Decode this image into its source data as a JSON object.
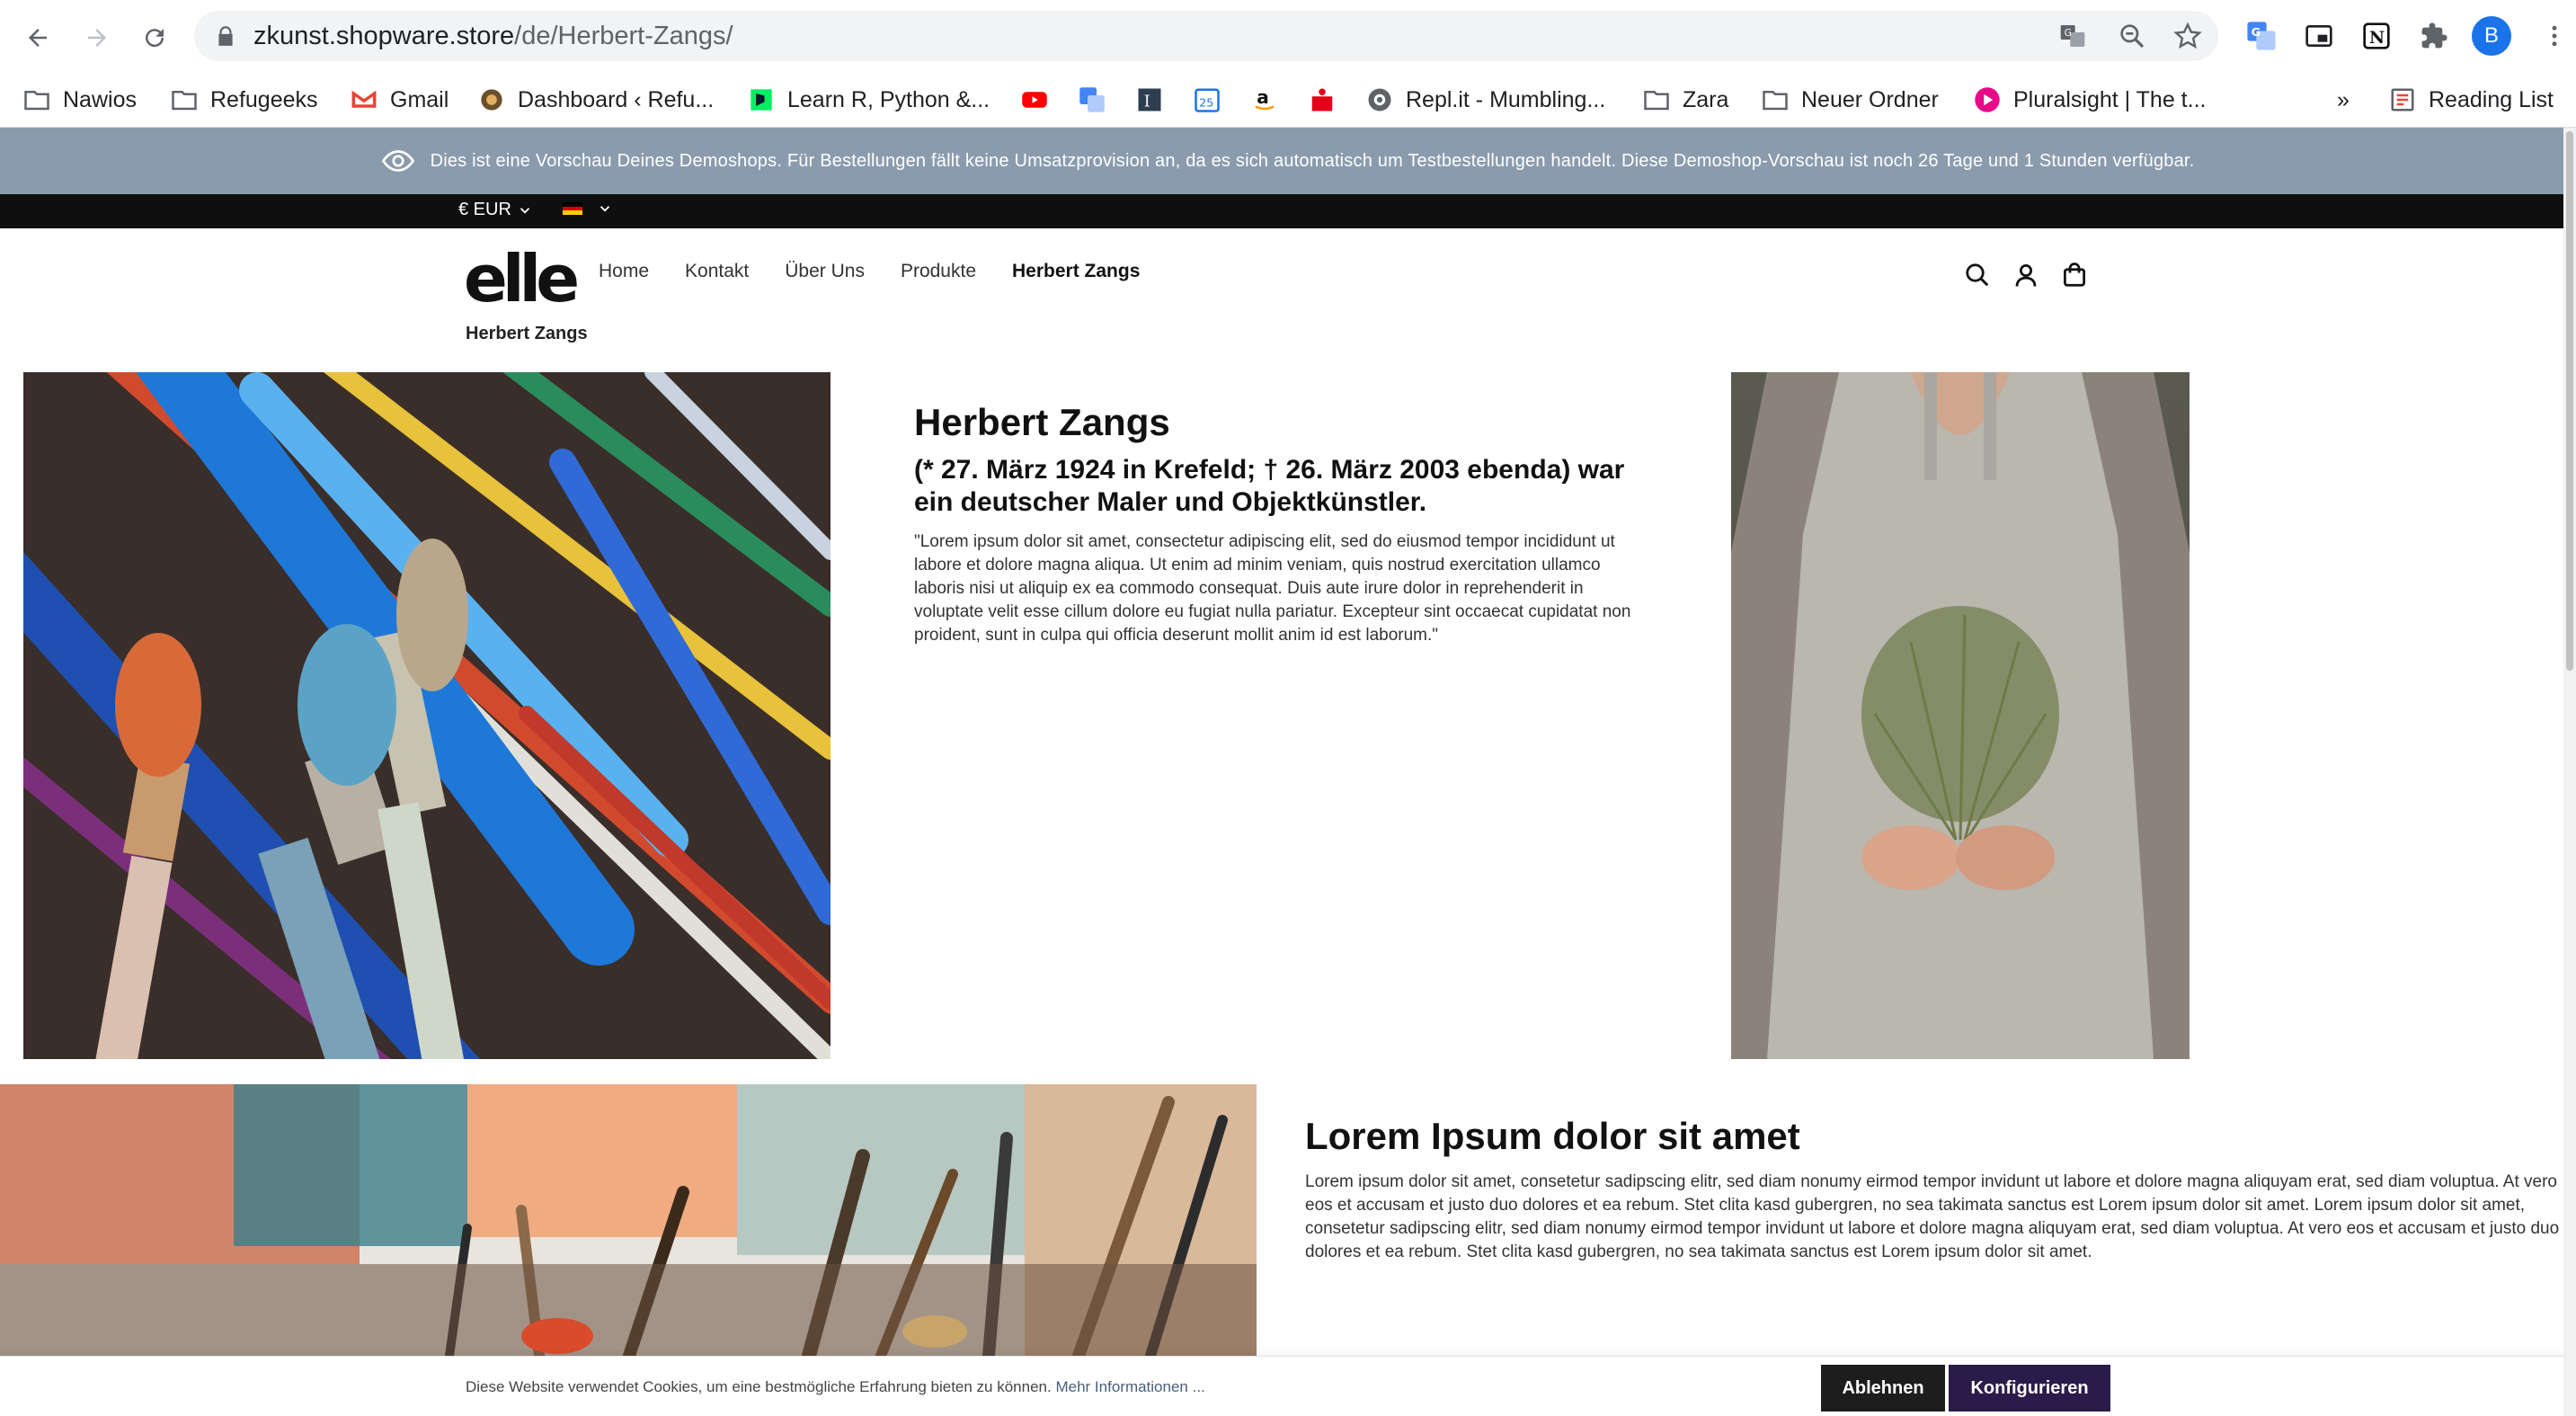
{
  "browser": {
    "url_host": "zkunst.shopware.store",
    "url_path": "/de/Herbert-Zangs/",
    "profile_initial": "B",
    "bookmarks": [
      {
        "label": "Nawios",
        "icon": "folder-icon"
      },
      {
        "label": "Refugeeks",
        "icon": "folder-icon"
      },
      {
        "label": "Gmail",
        "icon": "gmail-icon"
      },
      {
        "label": "Dashboard ‹ Refu...",
        "icon": "site-icon"
      },
      {
        "label": "Learn R, Python &...",
        "icon": "datacamp-icon"
      },
      {
        "label": "",
        "icon": "youtube-icon"
      },
      {
        "label": "",
        "icon": "translate-icon"
      },
      {
        "label": "",
        "icon": "notion-icon"
      },
      {
        "label": "",
        "icon": "calendar-icon"
      },
      {
        "label": "",
        "icon": "amazon-icon"
      },
      {
        "label": "",
        "icon": "sparkasse-icon"
      },
      {
        "label": "Repl.it - Mumbling...",
        "icon": "replit-icon"
      },
      {
        "label": "Zara",
        "icon": "folder-icon"
      },
      {
        "label": "Neuer Ordner",
        "icon": "folder-icon"
      },
      {
        "label": "Pluralsight | The t...",
        "icon": "pluralsight-icon"
      }
    ],
    "overflow": "»",
    "reading_list": "Reading List"
  },
  "preview_banner": "Dies ist eine Vorschau Deines Demoshops. Für Bestellungen fällt keine Umsatzprovision an, da es sich automatisch um Testbestellungen handelt. Diese Demoshop-Vorschau ist noch 26 Tage und 1 Stunden verfügbar.",
  "topbar": {
    "currency": "€ EUR"
  },
  "header": {
    "logo": "elle",
    "nav": [
      "Home",
      "Kontakt",
      "Über Uns",
      "Produkte",
      "Herbert Zangs"
    ],
    "breadcrumb": "Herbert Zangs"
  },
  "bio": {
    "title": "Herbert Zangs",
    "subtitle": "(* 27. März 1924 in Krefeld; † 26. März 2003 ebenda) war ein deutscher Maler und Objektkünstler.",
    "text": "\"Lorem ipsum dolor sit amet, consectetur adipiscing elit, sed do eiusmod tempor incididunt ut labore et dolore magna aliqua. Ut enim ad minim veniam, quis nostrud exercitation ullamco laboris nisi ut aliquip ex ea commodo consequat. Duis aute irure dolor in reprehenderit in voluptate velit esse cillum dolore eu fugiat nulla pariatur. Excepteur sint occaecat cupidatat non proident, sunt in culpa qui officia deserunt mollit anim id est laborum.\""
  },
  "section2": {
    "title": "Lorem Ipsum dolor sit amet",
    "text": "Lorem ipsum dolor sit amet, consetetur sadipscing elitr, sed diam nonumy eirmod tempor invidunt ut labore et dolore magna aliquyam erat, sed diam voluptua. At vero eos et accusam et justo duo dolores et ea rebum. Stet clita kasd gubergren, no sea takimata sanctus est Lorem ipsum dolor sit amet. Lorem ipsum dolor sit amet, consetetur sadipscing elitr, sed diam nonumy eirmod tempor invidunt ut labore et dolore magna aliquyam erat, sed diam voluptua. At vero eos et accusam et justo duo dolores et ea rebum. Stet clita kasd gubergren, no sea takimata sanctus est Lorem ipsum dolor sit amet."
  },
  "cookie": {
    "text": "Diese Website verwendet Cookies, um eine bestmögliche Erfahrung bieten zu können.",
    "link": "Mehr Informationen ...",
    "decline": "Ablehnen",
    "configure": "Konfigurieren"
  },
  "colors": {
    "preview_bar": "#8a9bae",
    "topbar": "#0f0f0f",
    "configure_button": "#2b1b4a",
    "decline_button": "#1d1d1d"
  }
}
